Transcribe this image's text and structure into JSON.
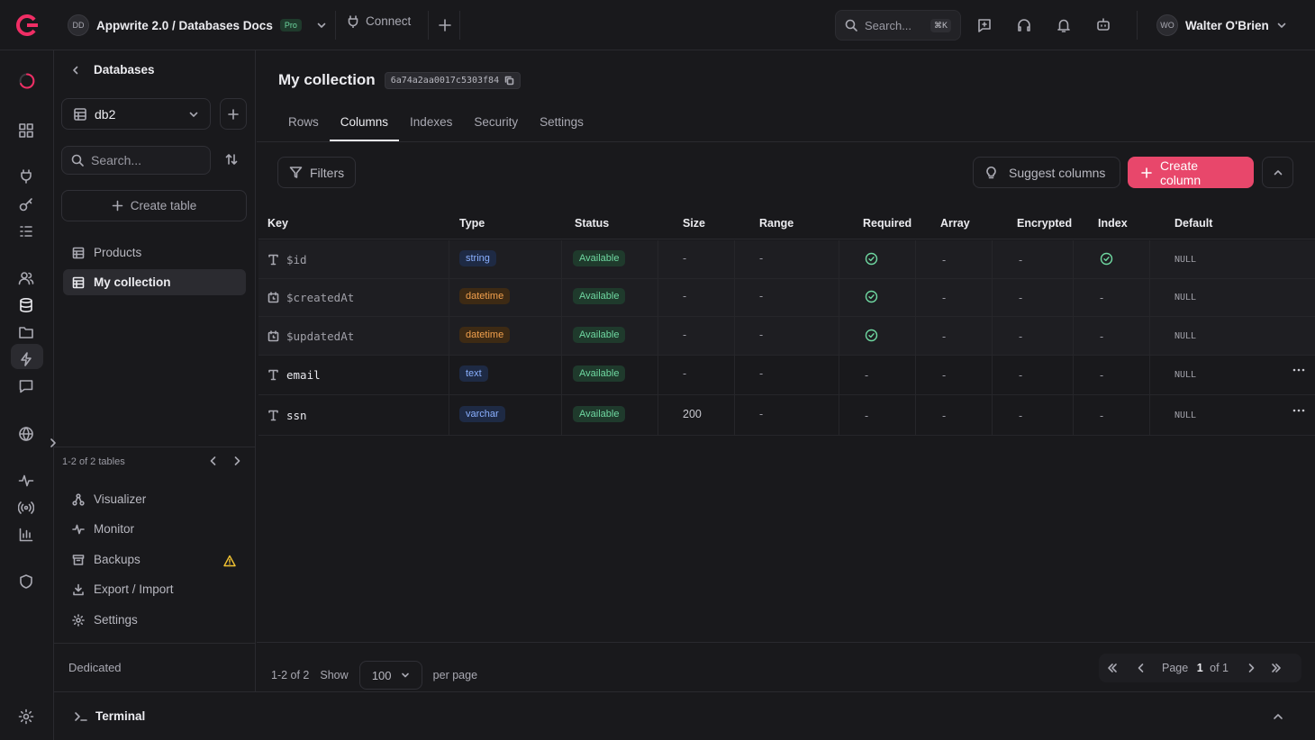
{
  "topbar": {
    "project_initials": "DD",
    "project_name": "Appwrite 2.0 / Databases Docs",
    "plan_badge": "Pro",
    "connect_label": "Connect",
    "search_placeholder": "Search...",
    "search_shortcut": "⌘K",
    "user_initials": "WO",
    "user_name": "Walter O'Brien"
  },
  "sidebar": {
    "back_label": "Databases",
    "database_selected": "db2",
    "search_placeholder": "Search...",
    "create_table_label": "Create table",
    "tables": [
      {
        "label": "Products"
      },
      {
        "label": "My collection"
      }
    ],
    "tables_count": "1-2 of 2 tables",
    "nav": [
      {
        "label": "Visualizer"
      },
      {
        "label": "Monitor"
      },
      {
        "label": "Backups"
      },
      {
        "label": "Export / Import"
      },
      {
        "label": "Settings"
      }
    ],
    "footer_label": "Dedicated"
  },
  "main": {
    "title": "My collection",
    "id": "6a74a2aa0017c5303f84",
    "tabs": [
      {
        "label": "Rows"
      },
      {
        "label": "Columns"
      },
      {
        "label": "Indexes"
      },
      {
        "label": "Security"
      },
      {
        "label": "Settings"
      }
    ],
    "active_tab": "Columns",
    "filters_label": "Filters",
    "suggest_label": "Suggest columns",
    "create_label": "Create column",
    "columns": [
      "Key",
      "Type",
      "Status",
      "Size",
      "Range",
      "Required",
      "Array",
      "Encrypted",
      "Index",
      "Default"
    ],
    "rows": [
      {
        "key": "$id",
        "type": "string",
        "status": "Available",
        "size": "-",
        "range": "-",
        "required": "check",
        "array": "-",
        "encrypted": "-",
        "index": "check",
        "default": "NULL"
      },
      {
        "key": "$createdAt",
        "type": "datetime",
        "status": "Available",
        "size": "-",
        "range": "-",
        "required": "check",
        "array": "-",
        "encrypted": "-",
        "index": "-",
        "default": "NULL"
      },
      {
        "key": "$updatedAt",
        "type": "datetime",
        "status": "Available",
        "size": "-",
        "range": "-",
        "required": "check",
        "array": "-",
        "encrypted": "-",
        "index": "-",
        "default": "NULL"
      },
      {
        "key": "email",
        "type": "text",
        "status": "Available",
        "size": "-",
        "range": "-",
        "required": "-",
        "array": "-",
        "encrypted": "-",
        "index": "-",
        "default": "NULL"
      },
      {
        "key": "ssn",
        "type": "varchar",
        "status": "Available",
        "size": "200",
        "range": "-",
        "required": "-",
        "array": "-",
        "encrypted": "-",
        "index": "-",
        "default": "NULL"
      }
    ],
    "footer": {
      "range": "1-2 of 2",
      "show_label": "Show",
      "per_page": "100",
      "per_page_label": "per page",
      "page_label": "Page",
      "page_current": "1",
      "page_of": "of 1"
    }
  },
  "terminal": {
    "label": "Terminal"
  },
  "colors": {
    "accent": "#e8476b",
    "success": "#6fd8a1",
    "warning": "#f1c232"
  }
}
